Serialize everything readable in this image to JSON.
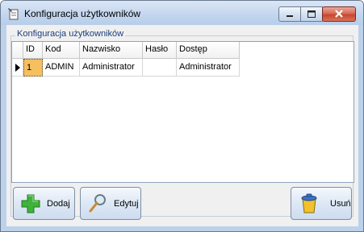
{
  "window": {
    "title": "Konfiguracja użytkowników"
  },
  "group": {
    "label": "Konfiguracja użytkowników"
  },
  "grid": {
    "columns": [
      "ID",
      "Kod",
      "Nazwisko",
      "Hasło",
      "Dostęp"
    ],
    "rows": [
      {
        "id": "1",
        "kod": "ADMIN",
        "nazwisko": "Administrator",
        "haslo": "",
        "dostep": "Administrator",
        "selected": true
      }
    ]
  },
  "buttons": {
    "add_label": "Dodaj",
    "edit_label": "Edytuj",
    "delete_label": "Usuń"
  },
  "colors": {
    "selected_cell": "#f6c060",
    "title_bar": "#c6d8ef",
    "close_button": "#c8462f"
  },
  "icons": {
    "app": "wrench-note-icon",
    "add": "plus-icon",
    "edit": "magnifier-icon",
    "delete": "trash-bin-icon"
  }
}
